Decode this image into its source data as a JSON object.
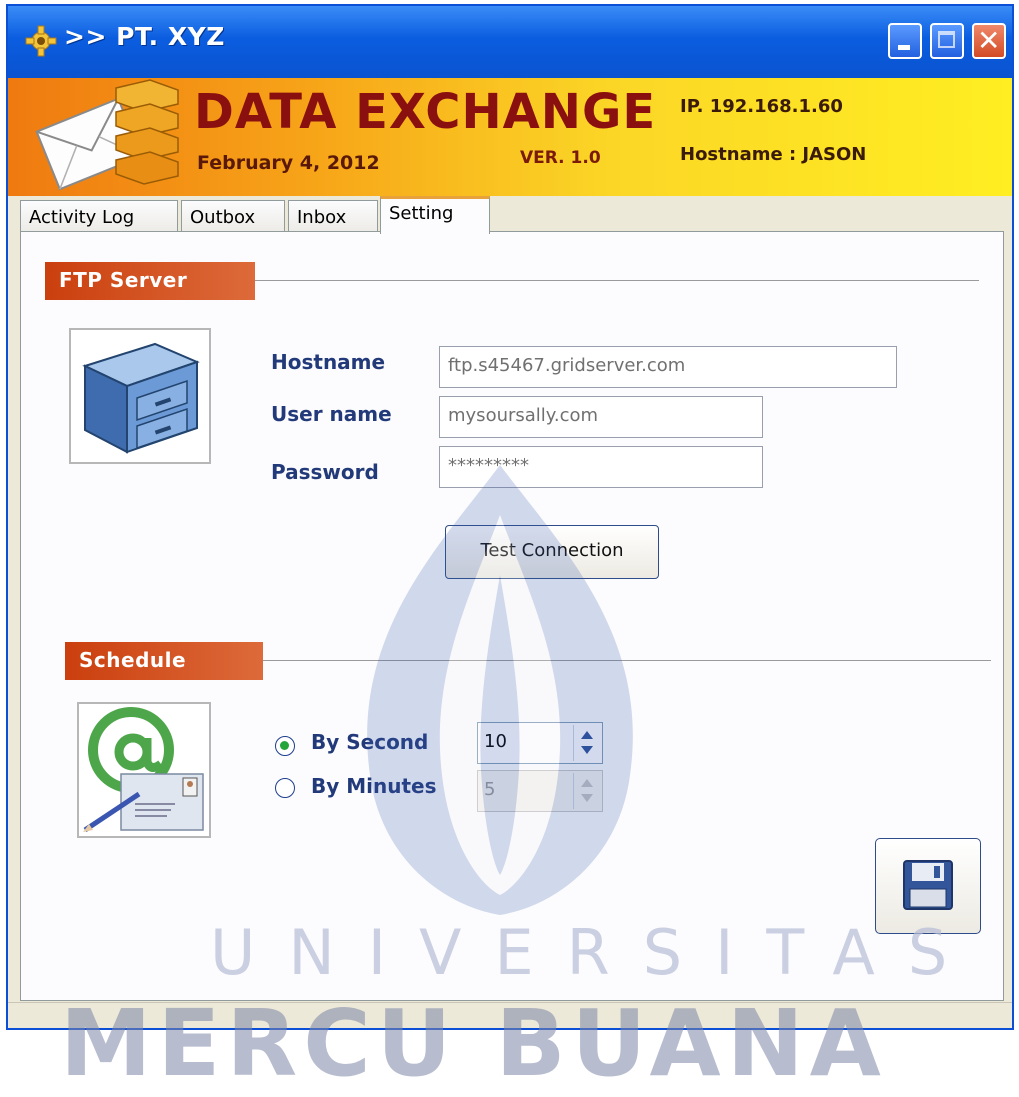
{
  "window": {
    "title": ">> PT. XYZ"
  },
  "banner": {
    "app_title": "DATA EXCHANGE",
    "date": "February 4, 2012",
    "version": "VER. 1.0",
    "ip": "IP. 192.168.1.60",
    "hostname": "Hostname : JASON"
  },
  "tabs": [
    {
      "label": "Activity Log",
      "active": false
    },
    {
      "label": "Outbox",
      "active": false
    },
    {
      "label": "Inbox",
      "active": false
    },
    {
      "label": "Setting",
      "active": true
    }
  ],
  "ftp": {
    "section_title": "FTP Server",
    "hostname_label": "Hostname",
    "hostname_value": "ftp.s45467.gridserver.com",
    "username_label": "User name",
    "username_value": "mysoursally.com",
    "password_label": "Password",
    "password_value": "*********",
    "test_button": "Test Connection"
  },
  "schedule": {
    "section_title": "Schedule",
    "by_second_label": "By Second",
    "by_second_value": "10",
    "by_second_selected": true,
    "by_minutes_label": "By Minutes",
    "by_minutes_value": "5",
    "by_minutes_selected": false
  },
  "watermark": {
    "line1": "UNIVERSITAS",
    "line2": "MERCU BUANA"
  },
  "icons": [
    "gear-icon",
    "minimize-icon",
    "maximize-icon",
    "close-icon",
    "data-exchange-logo",
    "server-cabinet-icon",
    "email-at-icon",
    "save-disk-icon"
  ],
  "colors": {
    "titlebar": "#0b5de0",
    "section_label": "#cb3f0e",
    "field_label": "#223a7a",
    "banner_title": "#8a1010"
  }
}
